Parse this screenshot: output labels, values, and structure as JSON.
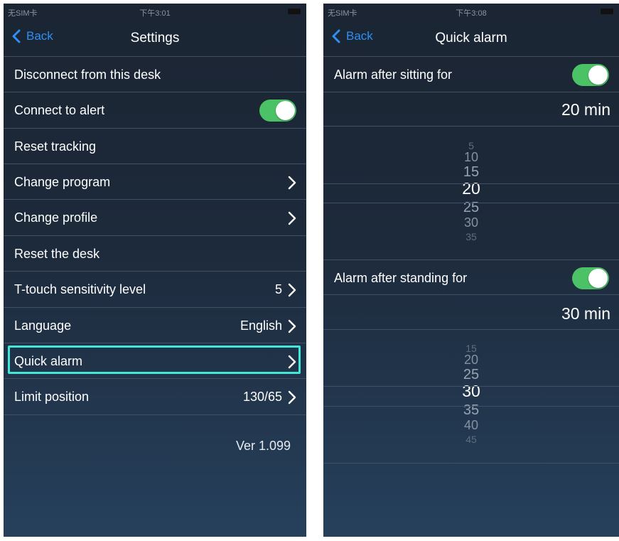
{
  "left": {
    "status": {
      "carrier": "无SIM卡",
      "time": "下午3:01"
    },
    "nav": {
      "back": "Back",
      "title": "Settings"
    },
    "rows": [
      {
        "label": "Disconnect from this desk"
      },
      {
        "label": "Connect to alert",
        "toggle": true
      },
      {
        "label": "Reset tracking"
      },
      {
        "label": "Change program"
      },
      {
        "label": "Change profile"
      },
      {
        "label": "Reset the desk"
      },
      {
        "label": "T-touch sensitivity level",
        "value": "5"
      },
      {
        "label": "Language",
        "value": "English"
      },
      {
        "label": "Quick alarm"
      },
      {
        "label": "Limit position",
        "value": "130/65"
      }
    ],
    "version": "Ver 1.099"
  },
  "right": {
    "status": {
      "carrier": "无SIM卡",
      "time": "下午3:08"
    },
    "nav": {
      "back": "Back",
      "title": "Quick alarm"
    },
    "sitting": {
      "label": "Alarm after sitting for",
      "enabled": true,
      "value": "20 min",
      "picker": [
        "5",
        "10",
        "15",
        "20",
        "25",
        "30",
        "35"
      ]
    },
    "standing": {
      "label": "Alarm after standing for",
      "enabled": true,
      "value": "30 min",
      "picker": [
        "15",
        "20",
        "25",
        "30",
        "35",
        "40",
        "45"
      ]
    }
  },
  "colors": {
    "accent": "#2f8ff3",
    "toggle_on": "#4cc266",
    "highlight": "#3fe8d8"
  }
}
